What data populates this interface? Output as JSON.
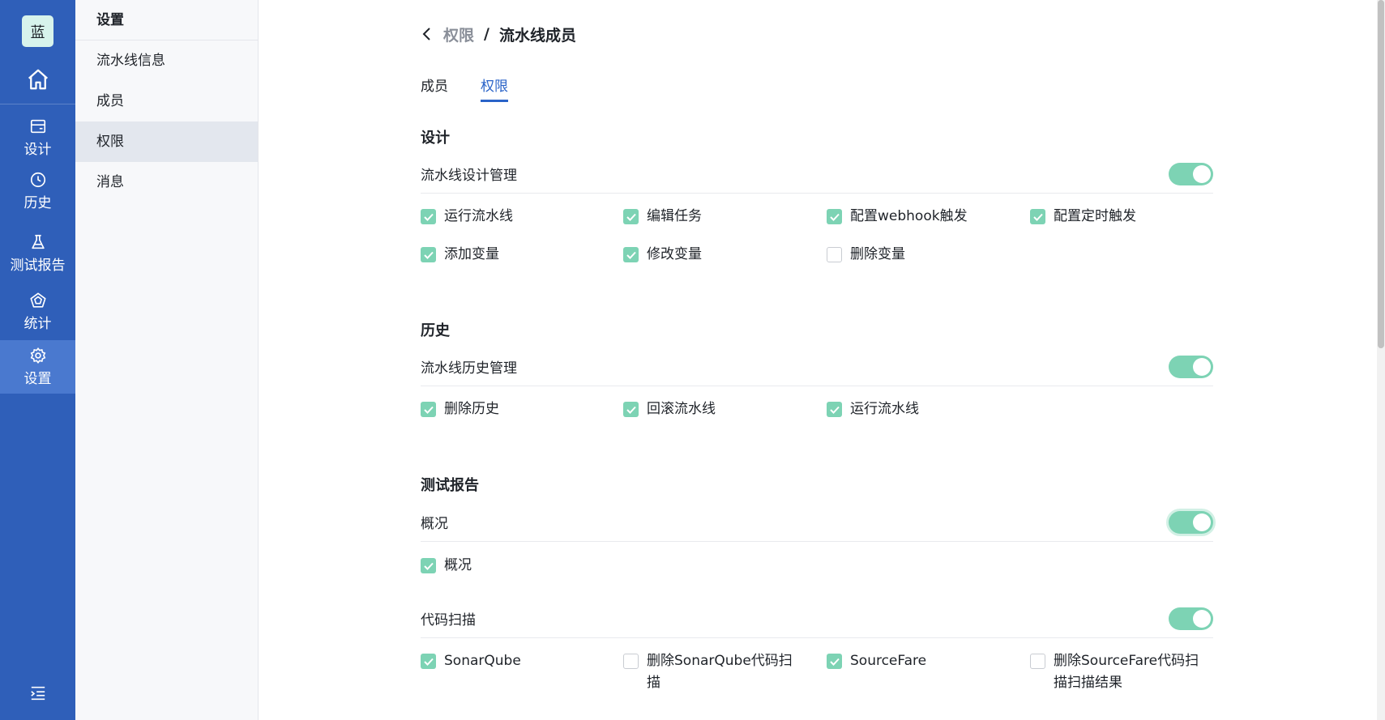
{
  "rail": {
    "logo": "蓝",
    "items": [
      {
        "label": "设计",
        "icon": "wallet-icon"
      },
      {
        "label": "历史",
        "icon": "clock-icon"
      },
      {
        "label": "测试报告",
        "icon": "flask-icon"
      },
      {
        "label": "统计",
        "icon": "pentagon-chart-icon"
      },
      {
        "label": "设置",
        "icon": "gear-icon"
      }
    ]
  },
  "submenu": {
    "title": "设置",
    "items": [
      {
        "label": "流水线信息"
      },
      {
        "label": "成员"
      },
      {
        "label": "权限"
      },
      {
        "label": "消息"
      }
    ]
  },
  "breadcrumb": {
    "parent": "权限",
    "separator": "/",
    "current": "流水线成员"
  },
  "tabs": [
    {
      "label": "成员"
    },
    {
      "label": "权限"
    }
  ],
  "sections": [
    {
      "title": "设计",
      "groups": [
        {
          "name": "流水线设计管理",
          "enabled": true,
          "perms": [
            {
              "label": "运行流水线",
              "checked": true
            },
            {
              "label": "编辑任务",
              "checked": true
            },
            {
              "label": "配置webhook触发",
              "checked": true
            },
            {
              "label": "配置定时触发",
              "checked": true
            },
            {
              "label": "添加变量",
              "checked": true
            },
            {
              "label": "修改变量",
              "checked": true
            },
            {
              "label": "删除变量",
              "checked": false
            }
          ]
        }
      ]
    },
    {
      "title": "历史",
      "groups": [
        {
          "name": "流水线历史管理",
          "enabled": true,
          "perms": [
            {
              "label": "删除历史",
              "checked": true
            },
            {
              "label": "回滚流水线",
              "checked": true
            },
            {
              "label": "运行流水线",
              "checked": true
            }
          ]
        }
      ]
    },
    {
      "title": "测试报告",
      "groups": [
        {
          "name": "概况",
          "enabled": true,
          "perms": [
            {
              "label": "概况",
              "checked": true
            }
          ]
        },
        {
          "name": "代码扫描",
          "enabled": true,
          "perms": [
            {
              "label": "SonarQube",
              "checked": true
            },
            {
              "label": "删除SonarQube代码扫描",
              "checked": false
            },
            {
              "label": "SourceFare",
              "checked": true
            },
            {
              "label": "删除SourceFare代码扫描扫描结果",
              "checked": false
            }
          ]
        }
      ]
    }
  ],
  "colors": {
    "rail": "#2f5fb9",
    "rail_active": "#4a79cf",
    "accent": "#2a63c8",
    "toggle_on": "#7dd3b4"
  }
}
